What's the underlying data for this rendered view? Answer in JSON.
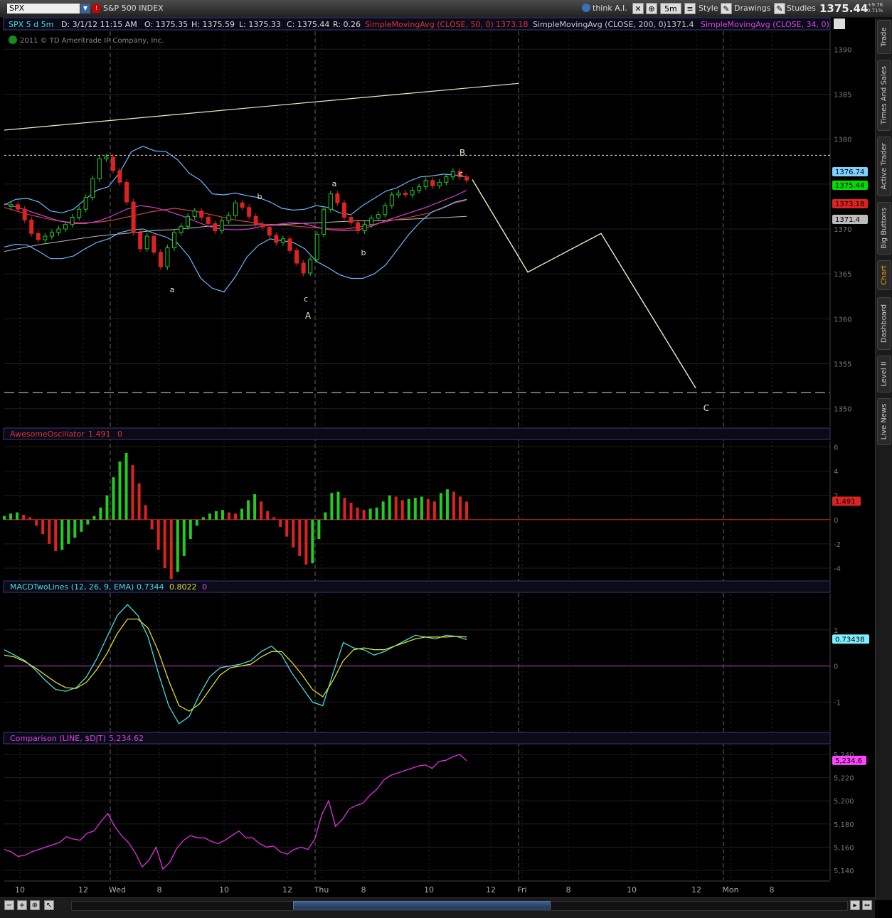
{
  "toolbar": {
    "symbol": "SPX",
    "symbol_name": "S&P 500 INDEX",
    "think_label": "think A.I.",
    "timeframe": "5m",
    "style_label": "Style",
    "drawings_label": "Drawings",
    "studies_label": "Studies",
    "last_price": "1375.44",
    "change_abs": "+9.76",
    "change_pct": "+0.71%"
  },
  "sidebar": {
    "tabs": [
      {
        "label": "Trade",
        "active": false
      },
      {
        "label": "Times And Sales",
        "active": false
      },
      {
        "label": "Active Trader",
        "active": false
      },
      {
        "label": "Big Buttons",
        "active": false
      },
      {
        "label": "Chart",
        "active": true
      },
      {
        "label": "Dashboard",
        "active": false
      },
      {
        "label": "Level II",
        "active": false
      },
      {
        "label": "Live News",
        "active": false
      }
    ]
  },
  "header": {
    "instrument": "SPX 5 d 5m",
    "datetime": "D: 3/1/12 11:15 AM",
    "open": "O: 1375.35",
    "high": "H: 1375.59",
    "low": "L: 1375.33",
    "close": "C: 1375.44",
    "range": "R: 0.26",
    "sma50_label": "SimpleMovingAvg (CLOSE, 50, 0)",
    "sma50_value": "1373.18",
    "sma200_label": "SimpleMovingAvg (CLOSE, 200, 0)",
    "sma200_value": "1371.4",
    "sma34_label": "SimpleMovingAvg (CLOSE, 34, 0)",
    "sma34_value": "1375.44",
    "copyright": "2011 © TD Ameritrade IP Company, Inc."
  },
  "colors": {
    "up": "#22cc22",
    "down": "#dd2222",
    "bollinger": "#6ab7ff",
    "sma50": "#d04040",
    "sma200": "#bbbbbb",
    "sma34": "#d040d0",
    "ema_fast": "#33dddd",
    "drawing": "#ecf0c0",
    "macd_line": "#44dddd",
    "macd_signal": "#dddd22",
    "comparison": "#e030e0",
    "zero_line": "#c040c0",
    "ao_zero": "#cc2222"
  },
  "price_tags": [
    {
      "value": "1376.74",
      "bg": "#7fd0ff",
      "fg": "#000"
    },
    {
      "value": "1375.44",
      "bg": "#00dd00",
      "fg": "#000"
    },
    {
      "value": "1373.18",
      "bg": "#dd2222",
      "fg": "#000"
    },
    {
      "value": "1371.4",
      "bg": "#bbbbbb",
      "fg": "#000"
    }
  ],
  "wave_labels": [
    "a",
    "b",
    "c",
    "A",
    "a",
    "b",
    "c",
    "B",
    "C"
  ],
  "panes": {
    "ao": {
      "label": "AwesomeOscillator",
      "value": "1.491",
      "zero": "0"
    },
    "macd": {
      "label": "MACDTwoLines (12, 26, 9, EMA)",
      "value": "0.7344",
      "signal": "0.8022",
      "zero": "0",
      "tag": "0.73438"
    },
    "cmp": {
      "label": "Comparison (LINE, $DJT)",
      "value": "5,234.62",
      "tag": "5,234.6"
    }
  },
  "chart_data": {
    "type": "candlestick",
    "x_axis_labels": [
      "10",
      "12",
      "Wed",
      "8",
      "10",
      "12",
      "Thu",
      "8",
      "10",
      "12",
      "Fri",
      "8",
      "10",
      "12",
      "Mon",
      "8"
    ],
    "price": {
      "ylim": [
        1348,
        1392
      ],
      "ticks": [
        1350,
        1355,
        1360,
        1365,
        1370,
        1375,
        1380,
        1385,
        1390
      ],
      "close_path": [
        1372.5,
        1372.7,
        1372.2,
        1371.0,
        1369.5,
        1368.8,
        1369.2,
        1369.6,
        1370.0,
        1370.5,
        1371.3,
        1372.2,
        1373.5,
        1375.6,
        1377.8,
        1378.0,
        1376.5,
        1375.2,
        1373.0,
        1369.6,
        1367.8,
        1369.2,
        1367.4,
        1365.8,
        1367.9,
        1369.6,
        1370.3,
        1371.4,
        1372.0,
        1371.3,
        1370.6,
        1369.8,
        1370.9,
        1371.5,
        1372.9,
        1372.4,
        1371.4,
        1370.5,
        1370.2,
        1369.3,
        1368.5,
        1368.9,
        1367.6,
        1366.2,
        1365.1,
        1366.6,
        1369.4,
        1372.2,
        1373.9,
        1372.9,
        1371.3,
        1370.7,
        1369.8,
        1370.5,
        1371.2,
        1371.6,
        1372.6,
        1373.8,
        1374.0,
        1373.8,
        1374.3,
        1374.7,
        1375.4,
        1374.8,
        1375.2,
        1375.8,
        1376.4,
        1375.8,
        1375.44
      ],
      "bollinger_upper": [
        1372.7,
        1373.3,
        1373.4,
        1373.0,
        1372.0,
        1371.8,
        1372.2,
        1373.3,
        1374.3,
        1374.7,
        1376.3,
        1378.6,
        1379.2,
        1378.7,
        1378.6,
        1377.7,
        1376.2,
        1375.4,
        1373.9,
        1373.8,
        1374.0,
        1373.7,
        1373.5,
        1373.0,
        1372.3,
        1372.1,
        1372.2,
        1372.6,
        1372.4,
        1371.8,
        1371.6,
        1372.6,
        1373.4,
        1374.2,
        1374.6,
        1375.3,
        1375.8,
        1375.9,
        1376.1,
        1376.0,
        1375.8
      ],
      "bollinger_lower": [
        1368.0,
        1368.3,
        1368.2,
        1367.5,
        1366.7,
        1366.7,
        1367.0,
        1367.8,
        1368.5,
        1368.9,
        1369.6,
        1369.9,
        1370.0,
        1369.5,
        1369.1,
        1368.4,
        1366.9,
        1364.5,
        1363.4,
        1363.0,
        1364.7,
        1366.9,
        1368.2,
        1368.9,
        1368.7,
        1368.5,
        1367.8,
        1366.4,
        1365.7,
        1364.9,
        1364.5,
        1364.5,
        1365.0,
        1366.0,
        1367.7,
        1369.4,
        1370.8,
        1371.9,
        1372.4,
        1373.0,
        1373.3
      ],
      "sma50": [
        1372.4,
        1372.0,
        1371.6,
        1371.3,
        1371.0,
        1370.8,
        1370.7,
        1370.7,
        1370.8,
        1371.0,
        1371.3,
        1371.6,
        1371.9,
        1372.1,
        1372.3,
        1372.1,
        1371.9,
        1371.6,
        1371.3,
        1371.0,
        1370.8,
        1370.6,
        1370.4,
        1370.4,
        1370.3,
        1370.2,
        1370.1,
        1370.0,
        1370.0,
        1370.2,
        1370.4,
        1370.7,
        1371.0,
        1371.2,
        1371.5,
        1371.8,
        1372.3,
        1372.9,
        1373.2
      ],
      "sma200": [
        1367.5,
        1367.9,
        1368.3,
        1368.6,
        1368.9,
        1369.2,
        1369.4,
        1369.6,
        1369.8,
        1369.9,
        1370.1,
        1370.3,
        1370.4,
        1370.4,
        1370.5,
        1370.5,
        1370.6,
        1370.7,
        1370.8,
        1370.9,
        1370.9,
        1371.0,
        1371.1,
        1371.2,
        1371.3,
        1371.4
      ],
      "sma34": [
        1372.8,
        1372.4,
        1371.9,
        1371.4,
        1370.9,
        1370.6,
        1370.6,
        1370.9,
        1371.5,
        1372.2,
        1372.6,
        1372.4,
        1372.0,
        1371.5,
        1370.9,
        1370.3,
        1370.0,
        1369.9,
        1370.0,
        1370.3,
        1370.5,
        1370.7,
        1370.6,
        1370.2,
        1369.9,
        1369.8,
        1369.9,
        1370.3,
        1370.9,
        1371.4,
        1371.9,
        1372.4,
        1373.0,
        1373.6,
        1374.3
      ],
      "trendline_start": 1381.0,
      "trendline_end": 1386.2,
      "resistance_dotted": 1378.2,
      "support_dashed": 1351.8,
      "projection": [
        1375.5,
        1365.2,
        1369.5,
        1352.3
      ]
    },
    "ao": {
      "ylim": [
        -5,
        6.5
      ],
      "ticks": [
        -4,
        -2,
        0,
        2,
        4,
        6
      ],
      "values": [
        0.3,
        0.5,
        0.6,
        0.4,
        0.2,
        -0.5,
        -1.2,
        -2.0,
        -2.6,
        -2.5,
        -2.0,
        -1.5,
        -1.0,
        -0.4,
        0.3,
        1.0,
        2.0,
        3.5,
        4.8,
        5.5,
        4.5,
        3.0,
        1.2,
        -0.8,
        -2.5,
        -4.0,
        -4.9,
        -4.3,
        -3.0,
        -1.6,
        -0.5,
        0.2,
        0.5,
        0.7,
        0.8,
        0.6,
        0.5,
        0.9,
        1.6,
        2.1,
        1.5,
        0.7,
        0.2,
        -0.6,
        -1.4,
        -2.3,
        -3.0,
        -3.7,
        -3.6,
        -1.6,
        0.6,
        2.2,
        2.3,
        1.8,
        1.4,
        1.0,
        0.8,
        0.9,
        1.0,
        1.5,
        2.0,
        1.9,
        1.6,
        1.7,
        1.8,
        1.9,
        1.7,
        1.5,
        2.2,
        2.5,
        2.3,
        1.9,
        1.491
      ]
    },
    "macd": {
      "ylim": [
        -1.8,
        2.0
      ],
      "ticks": [
        -1,
        0,
        1
      ],
      "macd": [
        0.45,
        0.3,
        0.15,
        -0.1,
        -0.4,
        -0.65,
        -0.7,
        -0.6,
        -0.3,
        0.2,
        0.8,
        1.4,
        1.7,
        1.4,
        0.8,
        -0.2,
        -1.1,
        -1.6,
        -1.4,
        -0.8,
        -0.3,
        -0.05,
        0.0,
        0.05,
        0.15,
        0.4,
        0.55,
        0.3,
        -0.2,
        -0.6,
        -1.0,
        -1.1,
        -0.2,
        0.65,
        0.5,
        0.45,
        0.3,
        0.4,
        0.55,
        0.7,
        0.85,
        0.8,
        0.75,
        0.85,
        0.82,
        0.73
      ],
      "signal": [
        0.3,
        0.25,
        0.12,
        -0.05,
        -0.25,
        -0.45,
        -0.6,
        -0.62,
        -0.45,
        -0.1,
        0.35,
        0.9,
        1.3,
        1.3,
        1.05,
        0.4,
        -0.4,
        -1.1,
        -1.25,
        -1.05,
        -0.65,
        -0.25,
        -0.05,
        0.0,
        0.05,
        0.25,
        0.4,
        0.4,
        0.1,
        -0.25,
        -0.65,
        -0.85,
        -0.4,
        0.15,
        0.45,
        0.5,
        0.45,
        0.45,
        0.55,
        0.65,
        0.75,
        0.8,
        0.8,
        0.8,
        0.82,
        0.8
      ]
    },
    "comparison": {
      "ylim": [
        5132,
        5248
      ],
      "ticks": [
        5140,
        5160,
        5180,
        5200,
        5220,
        5240
      ],
      "values": [
        5158,
        5156,
        5152,
        5153,
        5156,
        5158,
        5160,
        5162,
        5164,
        5169,
        5167,
        5166,
        5172,
        5174,
        5182,
        5189,
        5178,
        5170,
        5164,
        5155,
        5143,
        5149,
        5160,
        5141,
        5147,
        5159,
        5166,
        5170,
        5168,
        5168,
        5165,
        5163,
        5166,
        5170,
        5174,
        5168,
        5168,
        5163,
        5160,
        5161,
        5156,
        5154,
        5158,
        5160,
        5158,
        5167,
        5188,
        5200,
        5178,
        5184,
        5193,
        5196,
        5198,
        5205,
        5210,
        5218,
        5222,
        5224,
        5226,
        5228,
        5230,
        5231,
        5228,
        5234,
        5235,
        5238,
        5240,
        5234.62
      ]
    }
  }
}
